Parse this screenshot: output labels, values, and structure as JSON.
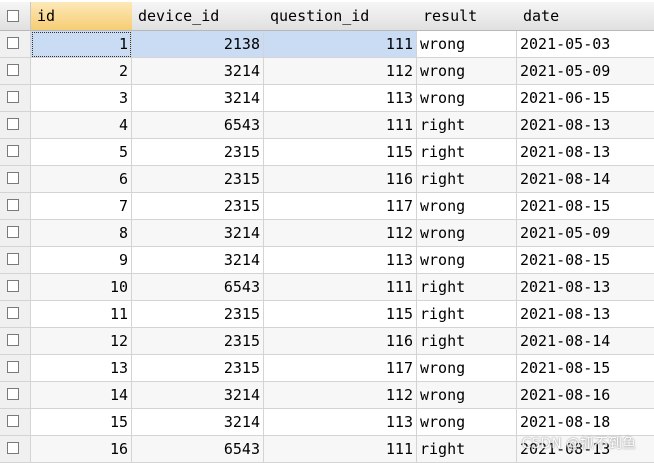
{
  "table": {
    "columns": [
      "id",
      "device_id",
      "question_id",
      "result",
      "date"
    ],
    "rows": [
      {
        "id": "1",
        "device_id": "2138",
        "question_id": "111",
        "result": "wrong",
        "date": "2021-05-03"
      },
      {
        "id": "2",
        "device_id": "3214",
        "question_id": "112",
        "result": "wrong",
        "date": "2021-05-09"
      },
      {
        "id": "3",
        "device_id": "3214",
        "question_id": "113",
        "result": "wrong",
        "date": "2021-06-15"
      },
      {
        "id": "4",
        "device_id": "6543",
        "question_id": "111",
        "result": "right",
        "date": "2021-08-13"
      },
      {
        "id": "5",
        "device_id": "2315",
        "question_id": "115",
        "result": "right",
        "date": "2021-08-13"
      },
      {
        "id": "6",
        "device_id": "2315",
        "question_id": "116",
        "result": "right",
        "date": "2021-08-14"
      },
      {
        "id": "7",
        "device_id": "2315",
        "question_id": "117",
        "result": "wrong",
        "date": "2021-08-15"
      },
      {
        "id": "8",
        "device_id": "3214",
        "question_id": "112",
        "result": "wrong",
        "date": "2021-05-09"
      },
      {
        "id": "9",
        "device_id": "3214",
        "question_id": "113",
        "result": "wrong",
        "date": "2021-08-15"
      },
      {
        "id": "10",
        "device_id": "6543",
        "question_id": "111",
        "result": "right",
        "date": "2021-08-13"
      },
      {
        "id": "11",
        "device_id": "2315",
        "question_id": "115",
        "result": "right",
        "date": "2021-08-13"
      },
      {
        "id": "12",
        "device_id": "2315",
        "question_id": "116",
        "result": "right",
        "date": "2021-08-14"
      },
      {
        "id": "13",
        "device_id": "2315",
        "question_id": "117",
        "result": "wrong",
        "date": "2021-08-15"
      },
      {
        "id": "14",
        "device_id": "3214",
        "question_id": "112",
        "result": "wrong",
        "date": "2021-08-16"
      },
      {
        "id": "15",
        "device_id": "3214",
        "question_id": "113",
        "result": "wrong",
        "date": "2021-08-18"
      },
      {
        "id": "16",
        "device_id": "6543",
        "question_id": "111",
        "result": "right",
        "date": "2021-08-13"
      }
    ],
    "selected_row_index": 0,
    "sorted_column": "id"
  },
  "watermark": "CSDN @抓不到鱼"
}
